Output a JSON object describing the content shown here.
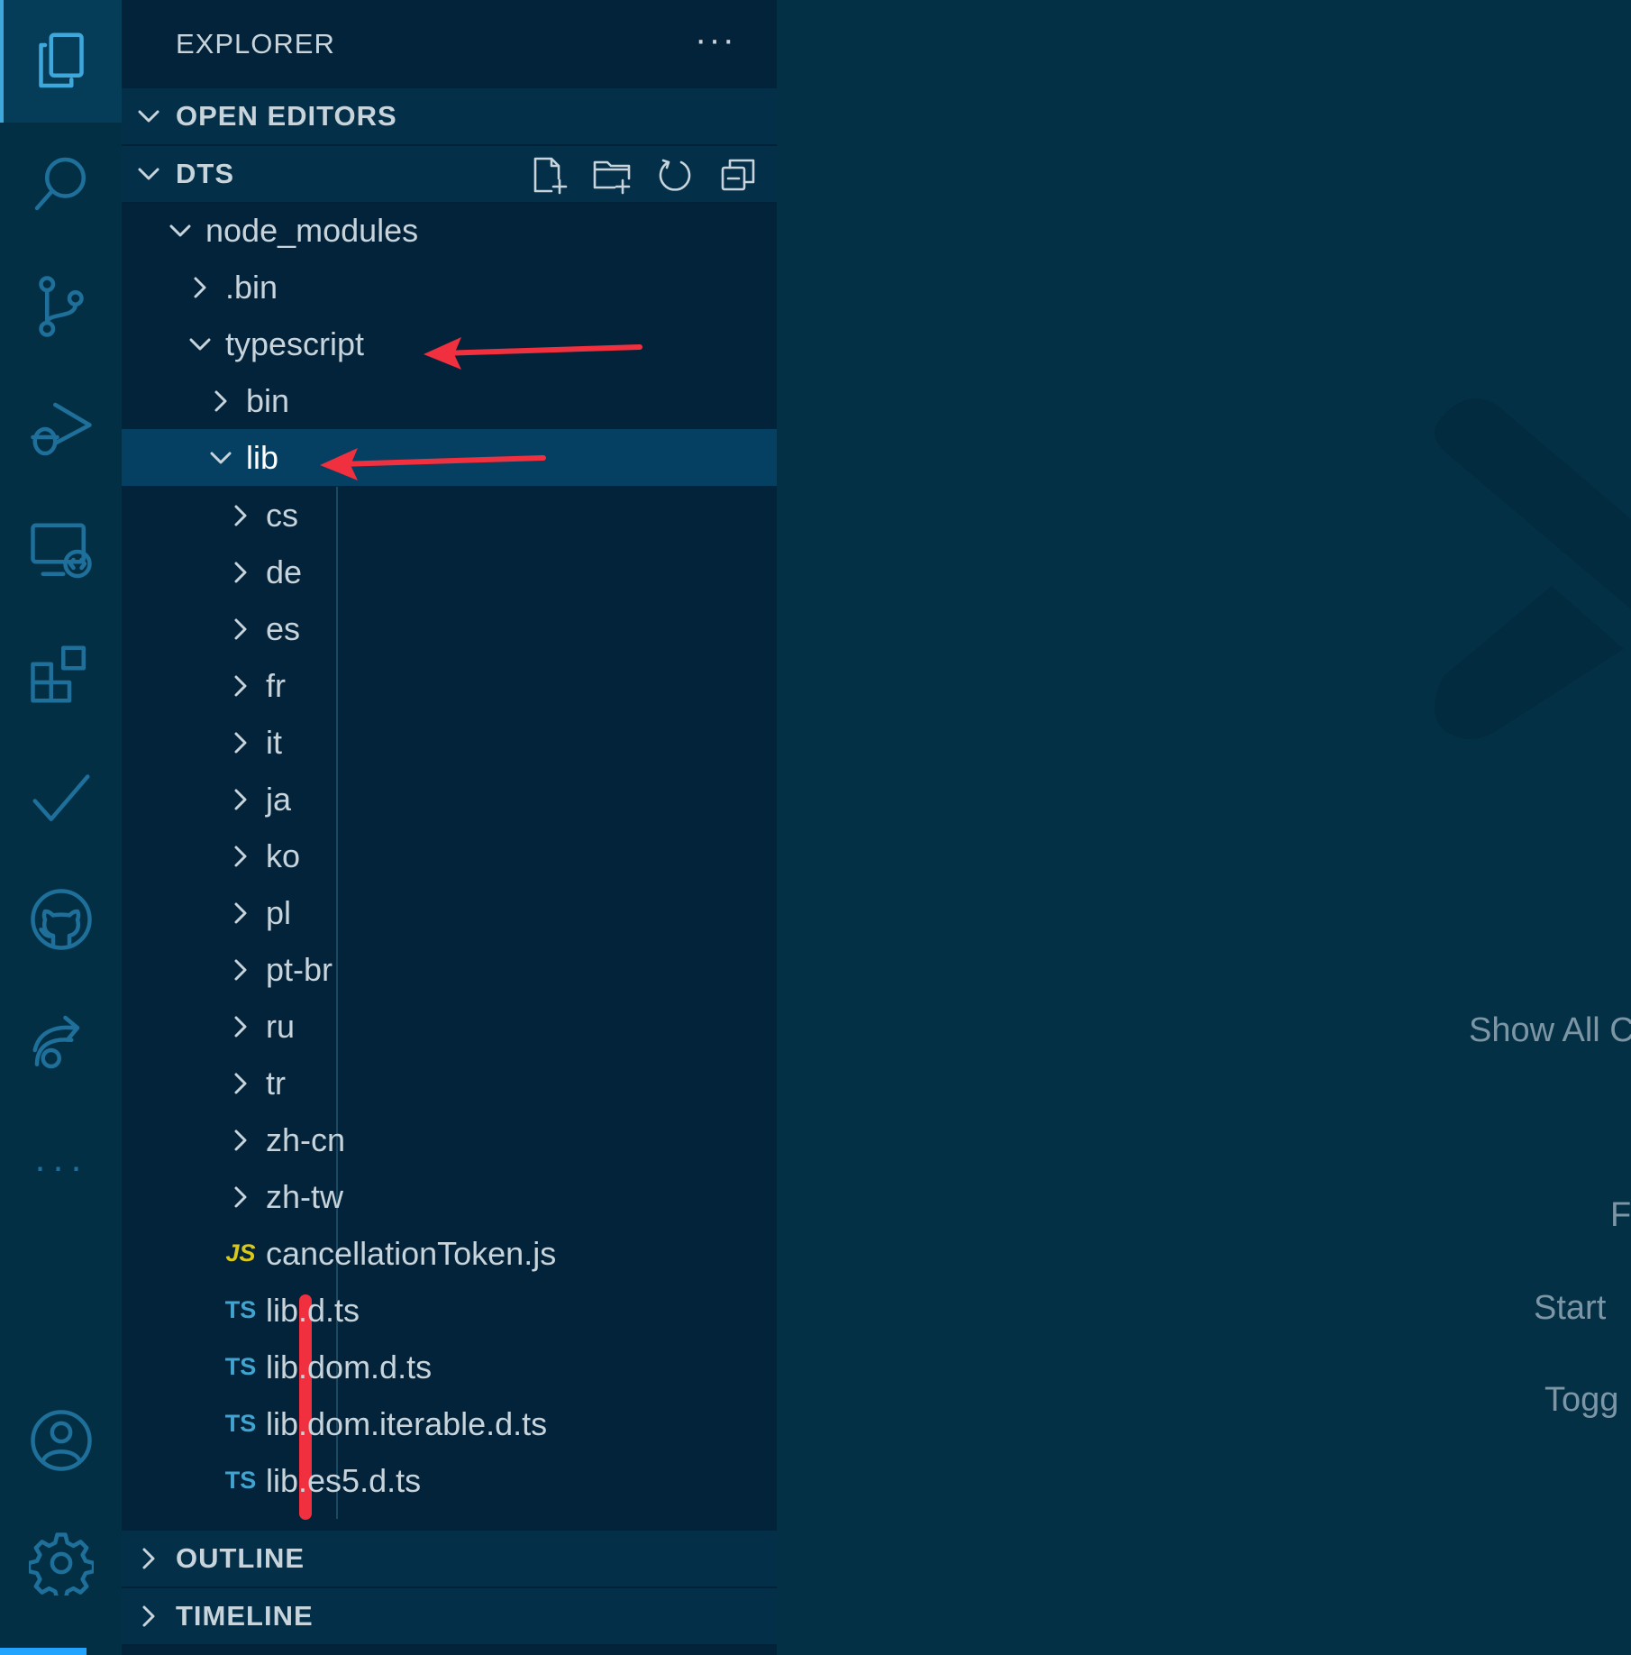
{
  "sidebar": {
    "title": "EXPLORER",
    "more": "···",
    "sections": {
      "open_editors": "OPEN EDITORS",
      "dts": "DTS",
      "outline": "OUTLINE",
      "timeline": "TIMELINE"
    },
    "tree": [
      {
        "label": "node_modules"
      },
      {
        "label": ".bin"
      },
      {
        "label": "typescript"
      },
      {
        "label": "bin"
      },
      {
        "label": "lib"
      },
      {
        "label": "cs"
      },
      {
        "label": "de"
      },
      {
        "label": "es"
      },
      {
        "label": "fr"
      },
      {
        "label": "it"
      },
      {
        "label": "ja"
      },
      {
        "label": "ko"
      },
      {
        "label": "pl"
      },
      {
        "label": "pt-br"
      },
      {
        "label": "ru"
      },
      {
        "label": "tr"
      },
      {
        "label": "zh-cn"
      },
      {
        "label": "zh-tw"
      },
      {
        "label": "cancellationToken.js",
        "badge": "JS"
      },
      {
        "label": "lib.d.ts",
        "badge": "TS"
      },
      {
        "label": "lib.dom.d.ts",
        "badge": "TS"
      },
      {
        "label": "lib.dom.iterable.d.ts",
        "badge": "TS"
      },
      {
        "label": "lib.es5.d.ts",
        "badge": "TS"
      }
    ]
  },
  "activity_bar": {
    "icons": [
      "explorer-icon",
      "search-icon",
      "source-control-icon",
      "run-debug-icon",
      "remote-explorer-icon",
      "extensions-icon",
      "testing-icon",
      "github-icon",
      "live-share-icon",
      "more-icon",
      "account-icon",
      "settings-gear-icon"
    ],
    "more": "···"
  },
  "editor": {
    "commands": [
      "Show All C",
      "F",
      "Start",
      "Togg"
    ]
  },
  "colors": {
    "annotation_red": "#f0303f",
    "accent_blue": "#22a3ff"
  }
}
